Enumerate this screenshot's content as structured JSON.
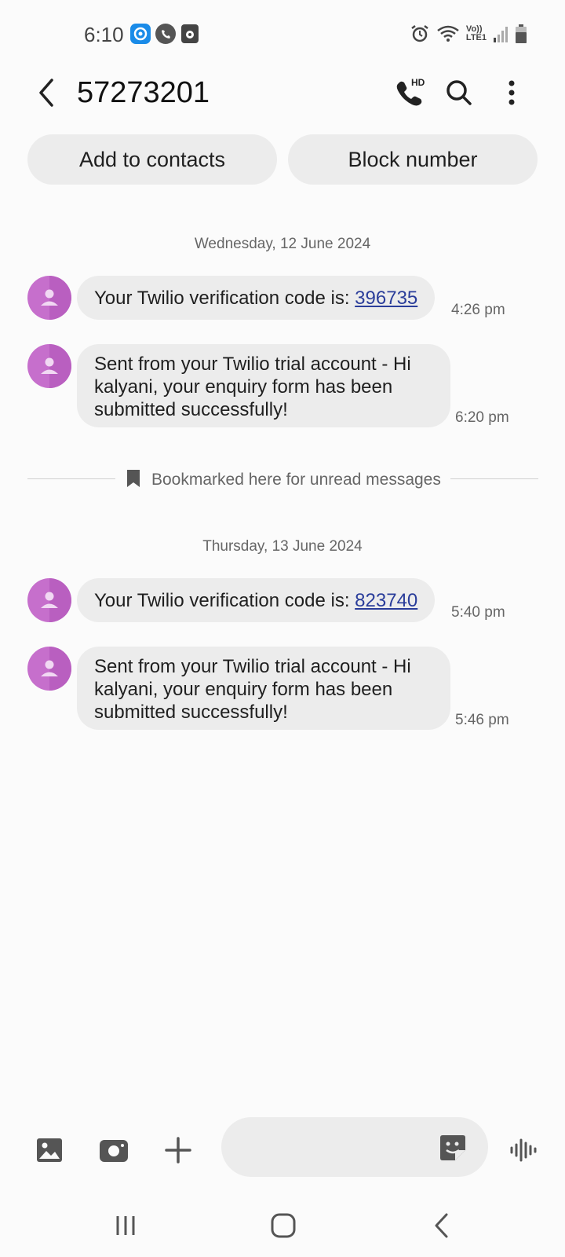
{
  "status_bar": {
    "time": "6:10",
    "network_label_top": "Vo))",
    "network_label_bottom": "LTE1"
  },
  "header": {
    "title": "57273201",
    "hd_label": "HD"
  },
  "actions": {
    "add_contacts": "Add to contacts",
    "block_number": "Block number"
  },
  "conversation": {
    "days": [
      {
        "date": "Wednesday, 12 June 2024",
        "messages": [
          {
            "text": "Your Twilio verification code is: ",
            "code": "396735",
            "time": "4:26 pm"
          },
          {
            "text": "Sent from your Twilio trial account - Hi kalyani, your enquiry form has been submitted successfully!",
            "time": "6:20 pm"
          }
        ]
      },
      {
        "date": "Thursday, 13 June 2024",
        "messages": [
          {
            "text": "Your Twilio verification code is: ",
            "code": "823740",
            "time": "5:40 pm"
          },
          {
            "text": "Sent from your Twilio trial account - Hi kalyani, your enquiry form has been submitted successfully!",
            "time": "5:46 pm"
          }
        ]
      }
    ],
    "bookmark_label": "Bookmarked here for unread messages"
  },
  "composer": {
    "placeholder": ""
  },
  "colors": {
    "avatar": "#c66fcc",
    "bubble": "#ececec",
    "link": "#2a3d9a",
    "background": "#fbfbfb"
  },
  "icons": [
    "back-icon",
    "hd-call-icon",
    "search-icon",
    "more-icon",
    "bookmark-icon",
    "gallery-icon",
    "camera-icon",
    "plus-icon",
    "sticker-icon",
    "voice-icon",
    "recents-nav-icon",
    "home-nav-icon",
    "back-nav-icon"
  ]
}
